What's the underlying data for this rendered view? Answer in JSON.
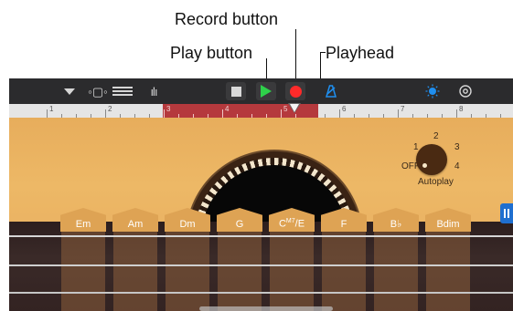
{
  "callouts": {
    "record": "Record button",
    "play": "Play button",
    "playhead": "Playhead"
  },
  "toolbar": {
    "icons": [
      "chevron-down-icon",
      "view-toggle-icon",
      "tracks-icon",
      "mixer-icon",
      "metronome-icon",
      "master-effects-icon",
      "settings-icon"
    ],
    "colors": {
      "background": "#2b2b2d",
      "play": "#2ed04a",
      "record": "#ff2a2a",
      "accent": "#1f8ff0"
    }
  },
  "ruler": {
    "numbers": [
      "1",
      "2",
      "3",
      "4",
      "5",
      "6",
      "7",
      "8"
    ]
  },
  "autoplay": {
    "label": "Autoplay",
    "positions": [
      "OFF",
      "1",
      "2",
      "3",
      "4"
    ],
    "selected": "OFF"
  },
  "chords": [
    "Em",
    "Am",
    "Dm",
    "G",
    "C",
    "F",
    "B♭",
    "Bdim"
  ],
  "chord_c": {
    "base": "C",
    "sup": "M7",
    "bass": "/E"
  }
}
